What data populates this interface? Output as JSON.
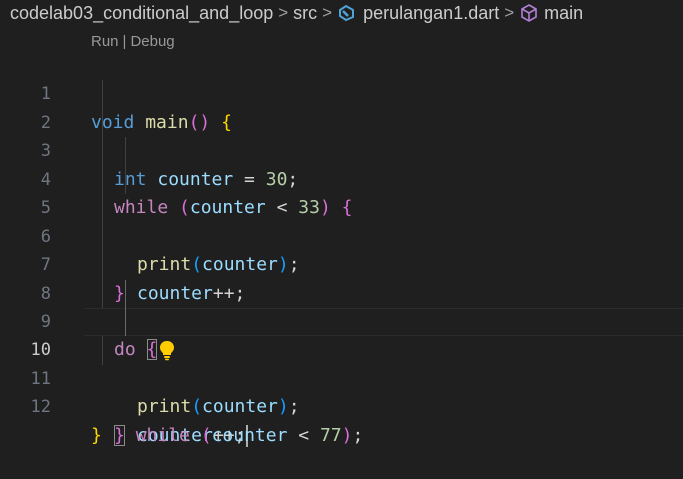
{
  "breadcrumb": {
    "project": "codelab03_conditional_and_loop",
    "folder": "src",
    "file": "perulangan1.dart",
    "symbol": "main",
    "separator": ">",
    "file_icon": "dart-file-icon",
    "symbol_icon": "method-cube-icon"
  },
  "codelens": {
    "run": "Run",
    "separator": "|",
    "debug": "Debug"
  },
  "gutter": {
    "line_numbers": [
      "1",
      "2",
      "3",
      "4",
      "5",
      "6",
      "7",
      "8",
      "9",
      "10",
      "11",
      "12"
    ],
    "active_line": "10"
  },
  "code": {
    "l1": {
      "t1": "void",
      "t2": " ",
      "t3": "main",
      "t4": "()",
      "t5": " ",
      "t6": "{"
    },
    "l2": {
      "t1": "int",
      "t2": " ",
      "t3": "counter",
      "t4": " = ",
      "t5": "30",
      "t6": ";"
    },
    "l3": {
      "t1": "while",
      "t2": " ",
      "t3": "(",
      "t4": "counter",
      "t5": " < ",
      "t6": "33",
      "t7": ")",
      "t8": " ",
      "t9": "{"
    },
    "l4": {
      "t1": "print",
      "t2": "(",
      "t3": "counter",
      "t4": ")",
      "t5": ";"
    },
    "l5": {
      "t1": "counter",
      "t2": "++;"
    },
    "l6": {
      "t1": "}"
    },
    "l8": {
      "t1": "do",
      "t2": " ",
      "t3": "{"
    },
    "l9": {
      "t1": "print",
      "t2": "(",
      "t3": "counter",
      "t4": ")",
      "t5": ";"
    },
    "l10": {
      "t1": "counter",
      "t2": "++;"
    },
    "l11": {
      "t1": "}",
      "t2": " ",
      "t3": "while",
      "t4": " ",
      "t5": "(",
      "t6": "counter",
      "t7": " < ",
      "t8": "77",
      "t9": ")",
      "t10": ";"
    },
    "l12": {
      "t1": "}"
    }
  },
  "lightbulb_icon": "lightbulb-icon",
  "colors": {
    "background": "#1f1f1f",
    "keyword_type": "#569cd6",
    "keyword_control": "#c586c0",
    "function": "#dcdcaa",
    "variable": "#9cdcfe",
    "number": "#b5cea8",
    "bracket_level1": "#ffd700",
    "bracket_level2": "#da70d6",
    "bracket_level3": "#179fff",
    "lightbulb": "#ffcc00"
  }
}
